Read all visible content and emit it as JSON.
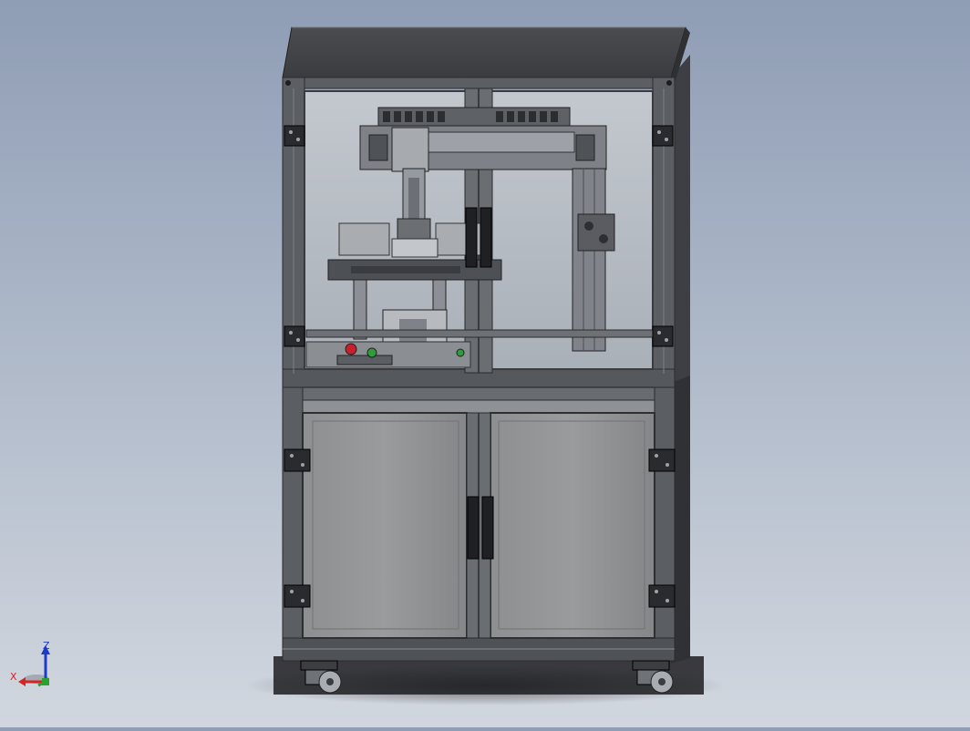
{
  "viewport": {
    "background_top": "#8f9db5",
    "background_bottom": "#d2d7df"
  },
  "triad": {
    "z_label": "Z",
    "x_label": "X",
    "z_color": "#1a3cc9",
    "x_color": "#d42424",
    "y_color": "#2aa12a"
  },
  "machine": {
    "frame_color": "#5b5e63",
    "panel_color": "#8a8b8d",
    "glass_color": "#b6bcc4",
    "estop_color": "#c8202a",
    "start_button_color": "#2f9d3a",
    "icons": [
      "cabinet-frame",
      "gantry-axis",
      "rotary-table",
      "control-panel",
      "door-handle",
      "caster-wheel",
      "hinge"
    ]
  }
}
